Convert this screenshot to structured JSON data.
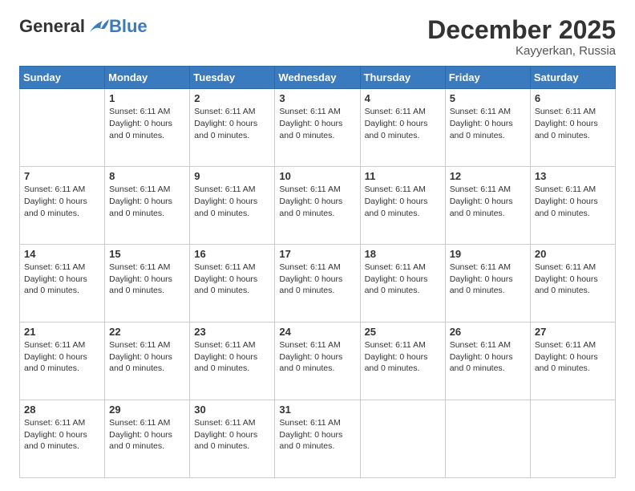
{
  "logo": {
    "general": "General",
    "blue": "Blue"
  },
  "title": "December 2025",
  "location": "Kayyerkan, Russia",
  "days_header": [
    "Sunday",
    "Monday",
    "Tuesday",
    "Wednesday",
    "Thursday",
    "Friday",
    "Saturday"
  ],
  "day_info": "Sunset: 6:11 AM\nDaylight: 0 hours and 0 minutes.",
  "weeks": [
    [
      {
        "num": "",
        "empty": true
      },
      {
        "num": "1",
        "empty": false
      },
      {
        "num": "2",
        "empty": false
      },
      {
        "num": "3",
        "empty": false
      },
      {
        "num": "4",
        "empty": false
      },
      {
        "num": "5",
        "empty": false
      },
      {
        "num": "6",
        "empty": false
      }
    ],
    [
      {
        "num": "7",
        "empty": false
      },
      {
        "num": "8",
        "empty": false
      },
      {
        "num": "9",
        "empty": false
      },
      {
        "num": "10",
        "empty": false
      },
      {
        "num": "11",
        "empty": false
      },
      {
        "num": "12",
        "empty": false
      },
      {
        "num": "13",
        "empty": false
      }
    ],
    [
      {
        "num": "14",
        "empty": false
      },
      {
        "num": "15",
        "empty": false
      },
      {
        "num": "16",
        "empty": false
      },
      {
        "num": "17",
        "empty": false
      },
      {
        "num": "18",
        "empty": false
      },
      {
        "num": "19",
        "empty": false
      },
      {
        "num": "20",
        "empty": false
      }
    ],
    [
      {
        "num": "21",
        "empty": false
      },
      {
        "num": "22",
        "empty": false
      },
      {
        "num": "23",
        "empty": false
      },
      {
        "num": "24",
        "empty": false
      },
      {
        "num": "25",
        "empty": false
      },
      {
        "num": "26",
        "empty": false
      },
      {
        "num": "27",
        "empty": false
      }
    ],
    [
      {
        "num": "28",
        "empty": false
      },
      {
        "num": "29",
        "empty": false
      },
      {
        "num": "30",
        "empty": false
      },
      {
        "num": "31",
        "empty": false
      },
      {
        "num": "",
        "empty": true
      },
      {
        "num": "",
        "empty": true
      },
      {
        "num": "",
        "empty": true
      }
    ]
  ]
}
